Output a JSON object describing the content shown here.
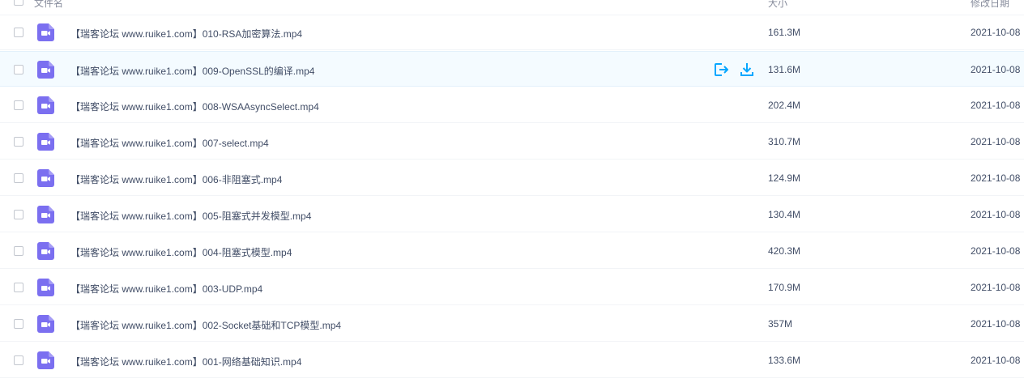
{
  "header": {
    "name_label": "文件名",
    "size_label": "大小",
    "date_label": "修改日期"
  },
  "colors": {
    "accent": "#06a7ff",
    "video_icon": "#7b6ff0",
    "hover_row": "#f4fbff"
  },
  "files": [
    {
      "name": "【瑞客论坛 www.ruike1.com】010-RSA加密算法.mp4",
      "size": "161.3M",
      "date": "2021-10-08",
      "icon": "video-file-icon"
    },
    {
      "name": "【瑞客论坛 www.ruike1.com】009-OpenSSL的编译.mp4",
      "size": "131.6M",
      "date": "2021-10-08",
      "icon": "video-file-icon",
      "hovered": true
    },
    {
      "name": "【瑞客论坛 www.ruike1.com】008-WSAAsyncSelect.mp4",
      "size": "202.4M",
      "date": "2021-10-08",
      "icon": "video-file-icon"
    },
    {
      "name": "【瑞客论坛 www.ruike1.com】007-select.mp4",
      "size": "310.7M",
      "date": "2021-10-08",
      "icon": "video-file-icon"
    },
    {
      "name": "【瑞客论坛 www.ruike1.com】006-非阻塞式.mp4",
      "size": "124.9M",
      "date": "2021-10-08",
      "icon": "video-file-icon"
    },
    {
      "name": "【瑞客论坛 www.ruike1.com】005-阻塞式并发模型.mp4",
      "size": "130.4M",
      "date": "2021-10-08",
      "icon": "video-file-icon"
    },
    {
      "name": "【瑞客论坛 www.ruike1.com】004-阻塞式模型.mp4",
      "size": "420.3M",
      "date": "2021-10-08",
      "icon": "video-file-icon"
    },
    {
      "name": "【瑞客论坛 www.ruike1.com】003-UDP.mp4",
      "size": "170.9M",
      "date": "2021-10-08",
      "icon": "video-file-icon"
    },
    {
      "name": "【瑞客论坛 www.ruike1.com】002-Socket基础和TCP模型.mp4",
      "size": "357M",
      "date": "2021-10-08",
      "icon": "video-file-icon"
    },
    {
      "name": "【瑞客论坛 www.ruike1.com】001-网络基础知识.mp4",
      "size": "133.6M",
      "date": "2021-10-08",
      "icon": "video-file-icon"
    }
  ],
  "row_actions": {
    "share_icon": "share-icon",
    "download_icon": "download-icon"
  }
}
